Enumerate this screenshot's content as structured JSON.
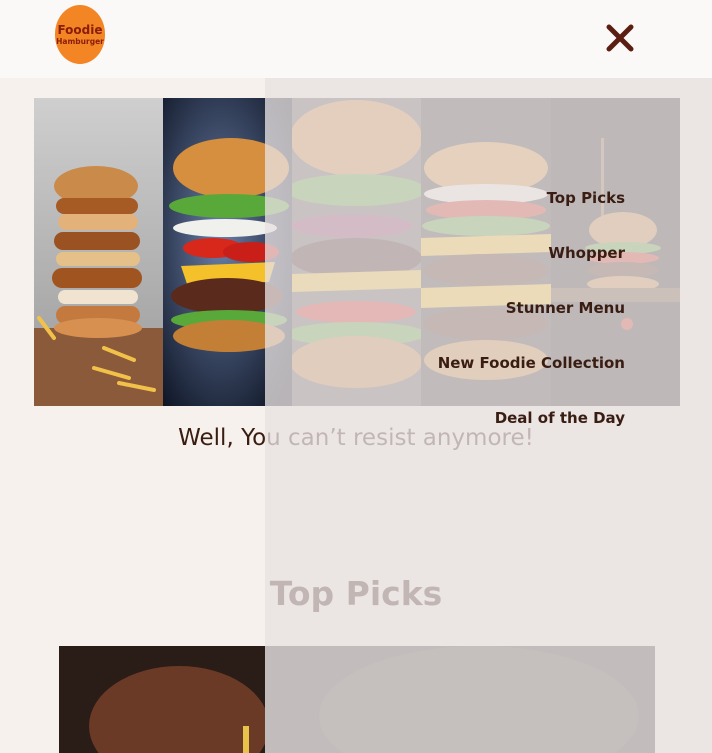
{
  "brand": {
    "line1": "Foodie",
    "line2": "Hamburger"
  },
  "header": {
    "close_icon": "close-icon"
  },
  "hero": {
    "tagline": "Well, You can’t resist anymore!"
  },
  "nav": {
    "items": [
      {
        "label": "Top Picks"
      },
      {
        "label": "Whopper"
      },
      {
        "label": "Stunner Menu"
      },
      {
        "label": "New Foodie Collection"
      },
      {
        "label": "Deal of the Day"
      }
    ]
  },
  "section": {
    "title": "Top Picks"
  },
  "colors": {
    "background": "#f6f1ed",
    "header": "#fbf9f8",
    "logo": "#f38524",
    "text": "#3a1d12",
    "overlay": "#e8e1e1"
  }
}
